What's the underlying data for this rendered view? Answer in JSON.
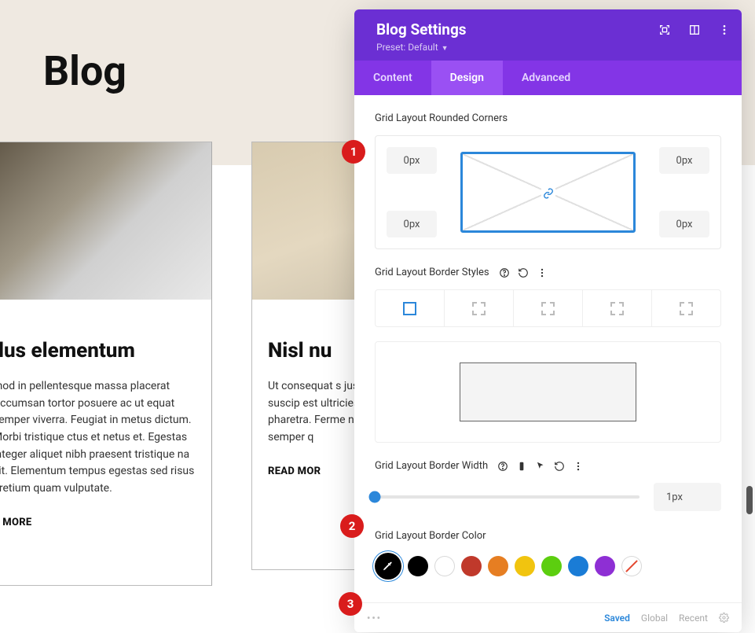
{
  "page": {
    "title": "Blog"
  },
  "cards": [
    {
      "title": "llus elementum",
      "text": "mod in pellentesque massa placerat Accumsan tortor posuere ac ut equat semper viverra. Feugiat in metus dictum. Morbi tristique ctus et netus et. Egestas integer aliquet nibh praesent tristique na sit. Elementum tempus egestas sed risus pretium quam vulputate.",
      "link": "D MORE"
    },
    {
      "title": "Nisl nu",
      "text": "Ut consequat s justo laoreet sit amet nisl suscip est ultricies. Fe diam. Donec en pharetra. Ferme non pulvinar n vitae semper q",
      "link": "READ MOR"
    }
  ],
  "panel": {
    "title": "Blog Settings",
    "preset_label": "Preset: Default",
    "tabs": {
      "content": "Content",
      "design": "Design",
      "advanced": "Advanced"
    },
    "corners": {
      "label": "Grid Layout Rounded Corners",
      "tl": "0px",
      "tr": "0px",
      "bl": "0px",
      "br": "0px"
    },
    "border_styles": {
      "label": "Grid Layout Border Styles"
    },
    "border_width": {
      "label": "Grid Layout Border Width",
      "value": "1px"
    },
    "border_color": {
      "label": "Grid Layout Border Color",
      "swatches": [
        "#000000",
        "#ffffff",
        "#c0392b",
        "#e67e22",
        "#f1c40f",
        "#5cce0f",
        "#1a7cd6",
        "#8e2fd4"
      ]
    },
    "footer": {
      "saved": "Saved",
      "global": "Global",
      "recent": "Recent"
    }
  },
  "badges": {
    "b1": "1",
    "b2": "2",
    "b3": "3"
  }
}
